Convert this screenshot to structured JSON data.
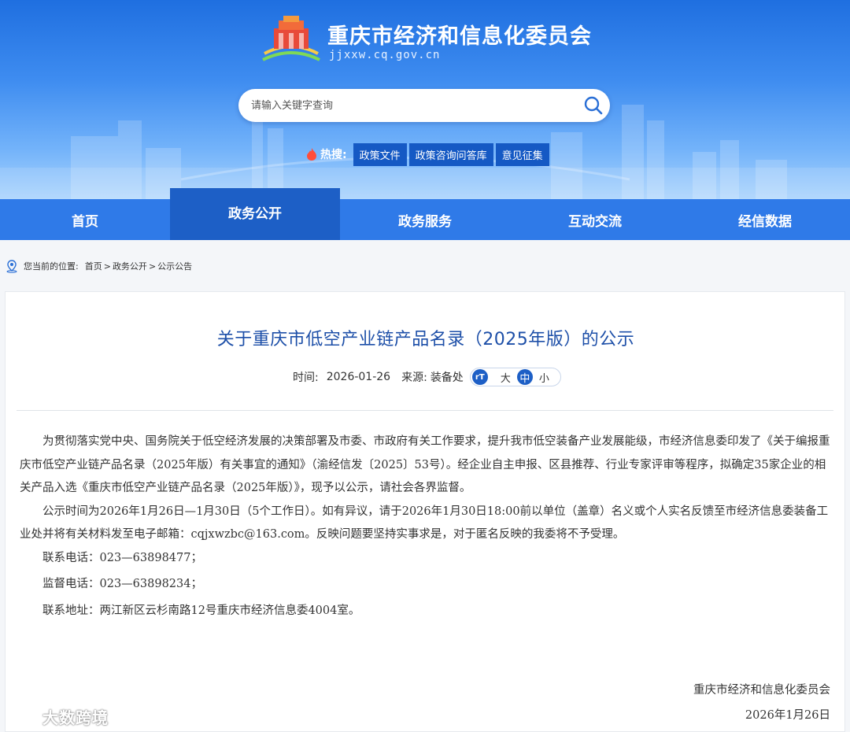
{
  "header": {
    "site_title": "重庆市经济和信息化委员会",
    "site_url": "jjxxw.cq.gov.cn",
    "search_placeholder": "请输入关键字查询",
    "hot_label": "热搜:",
    "hot_tags": [
      "政策文件",
      "政策咨询问答库",
      "意见征集"
    ]
  },
  "nav": {
    "items": [
      "首页",
      "政务公开",
      "政务服务",
      "互动交流",
      "经信数据"
    ],
    "active": "政务公开"
  },
  "breadcrumb": {
    "label": "您当前的位置:",
    "path": [
      "首页",
      "政务公开",
      "公示公告"
    ],
    "sep": ">"
  },
  "article": {
    "title": "关于重庆市低空产业链产品名录（2025年版）的公示",
    "time_label": "时间:",
    "date": "2026-01-26",
    "source_label": "来源:",
    "source": "装备处",
    "font_sizes": [
      "大",
      "中",
      "小"
    ],
    "font_icon": "rT",
    "paragraph1": "为贯彻落实党中央、国务院关于低空经济发展的决策部署及市委、市政府有关工作要求，提升我市低空装备产业发展能级，市经济信息委印发了《关于编报重庆市低空产业链产品名录（2025年版）有关事宜的通知》（渝经信发〔2025〕53号）。经企业自主申报、区县推荐、行业专家评审等程序，拟确定35家企业的相关产品入选《重庆市低空产业链产品名录（2025年版）》，现予以公示，请社会各界监督。",
    "paragraph2": "公示时间为2026年1月26日—1月30日（5个工作日）。如有异议，请于2026年1月30日18:00前以单位（盖章）名义或个人实名反馈至市经济信息委装备工业处并将有关材料发至电子邮箱：cqjxwzbc@163.com。反映问题要坚持实事求是，对于匿名反映的我委将不予受理。",
    "contact_phone": "联系电话：023—63898477；",
    "supervise_phone": "监督电话：023—63898234；",
    "address": "联系地址：两江新区云杉南路12号重庆市经济信息委4004室。",
    "sign_org": "重庆市经济和信息化委员会",
    "sign_date": "2026年1月26日"
  },
  "watermark": {
    "text": "大数跨境"
  },
  "colors": {
    "brand_blue": "#1d5fc6",
    "nav_blue": "#2f7ae8",
    "title_blue": "#1d4fa8"
  }
}
